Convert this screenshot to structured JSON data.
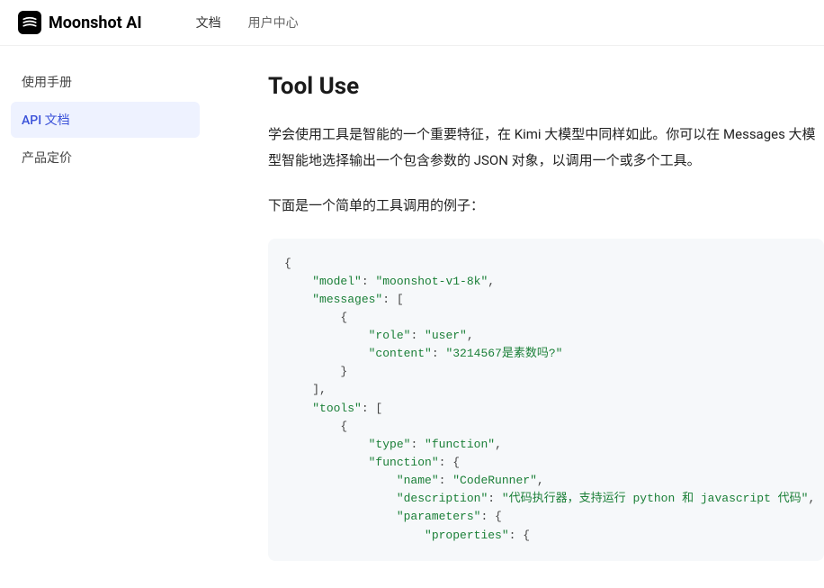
{
  "header": {
    "brand": "Moonshot AI",
    "nav": [
      {
        "label": "文档",
        "active": true
      },
      {
        "label": "用户中心",
        "active": false
      }
    ]
  },
  "sidebar": {
    "items": [
      {
        "label": "使用手册",
        "active": false
      },
      {
        "label": "API 文档",
        "active": true
      },
      {
        "label": "产品定价",
        "active": false
      }
    ]
  },
  "page": {
    "title": "Tool Use",
    "para1": "学会使用工具是智能的一个重要特征，在 Kimi 大模型中同样如此。你可以在 Messages 大模型智能地选择输出一个包含参数的 JSON 对象，以调用一个或多个工具。",
    "para2": "下面是一个简单的工具调用的例子："
  },
  "code": {
    "model_k": "\"model\"",
    "model_v": "\"moonshot-v1-8k\"",
    "messages_k": "\"messages\"",
    "role_k": "\"role\"",
    "role_v": "\"user\"",
    "content_k": "\"content\"",
    "content_v": "\"3214567是素数吗?\"",
    "tools_k": "\"tools\"",
    "type_k": "\"type\"",
    "type_v": "\"function\"",
    "function_k": "\"function\"",
    "name_k": "\"name\"",
    "name_v": "\"CodeRunner\"",
    "description_k": "\"description\"",
    "description_v": "\"代码执行器，支持运行 python 和 javascript 代码\"",
    "parameters_k": "\"parameters\"",
    "properties_k": "\"properties\""
  }
}
